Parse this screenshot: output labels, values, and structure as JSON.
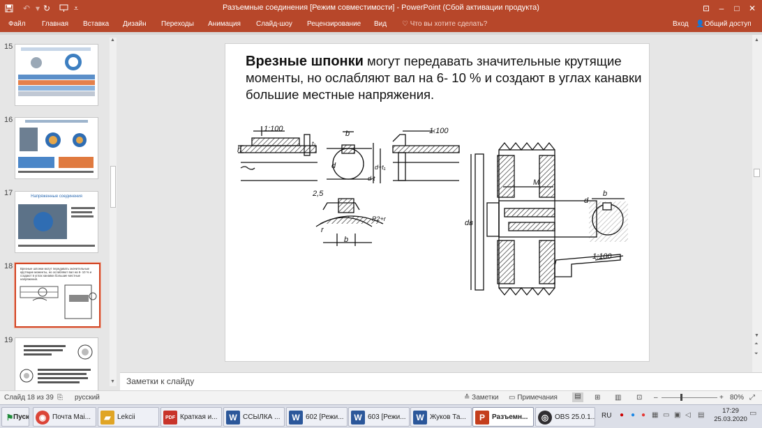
{
  "window": {
    "title": "Разъемные соединения [Режим совместимости] - PowerPoint (Сбой активации продукта)"
  },
  "quick_access": {
    "save_icon": "save-icon",
    "undo_icon": "undo-icon",
    "redo_icon": "redo-icon",
    "slideshow_icon": "present-icon",
    "customize_icon": "chevron-down-icon"
  },
  "window_controls": {
    "restore_icon": "ribbon-display-icon",
    "minimize": "–",
    "maximize": "□",
    "close": "✕"
  },
  "ribbon": {
    "tabs": [
      "Файл",
      "Главная",
      "Вставка",
      "Дизайн",
      "Переходы",
      "Анимация",
      "Слайд-шоу",
      "Рецензирование",
      "Вид"
    ],
    "tell_me": "Что вы хотите сделать?",
    "login": "Вход",
    "share": "Общий доступ"
  },
  "thumbnails": [
    {
      "num": "15",
      "caption": ""
    },
    {
      "num": "16",
      "caption": ""
    },
    {
      "num": "17",
      "caption": "Напряженные соединения"
    },
    {
      "num": "18",
      "caption": "Врезные шпонки могут передавать значительные крутящие моменты, но ослабляют вал на 6- 10 % и создают в углах канавки большие местные напряжения."
    },
    {
      "num": "19",
      "caption": "Шпонки на лыске"
    }
  ],
  "slide": {
    "title_bold": "Врезные шпонки",
    "title_rest": " могут передавать значительные крутящие моменты, но ослабляют вал на 6- 10 % и создают в углах  канавки большие местные напряжения.",
    "drawing_labels": {
      "slope1": "1:100",
      "slope2": "1:100",
      "slope3": "1:100",
      "h": "h",
      "t1": "t₁",
      "b": "b",
      "d": "d",
      "d_t": "d-t",
      "d_t1": "d+t₁",
      "r25": "2,5",
      "r": "r",
      "R": "R2+r",
      "M": "M",
      "dB": "dв",
      "d2": "d",
      "b2": "b"
    }
  },
  "notes": {
    "placeholder": "Заметки к слайду"
  },
  "status": {
    "slide": "Слайд 18 из 39",
    "lang": "русский",
    "notes": "Заметки",
    "comments": "Примечания",
    "zoom": "80%",
    "minus": "–",
    "plus": "+"
  },
  "taskbar": {
    "start": "Пуск",
    "items": [
      {
        "label": "Почта Mai...",
        "icon": "chrome-icon",
        "color": "#db4437"
      },
      {
        "label": "Lekcii",
        "icon": "folder-icon",
        "color": "#e0a526"
      },
      {
        "label": "Краткая и...",
        "icon": "pdf-icon",
        "color": "#c8342a"
      },
      {
        "label": "ССЫЛКА ...",
        "icon": "word-icon",
        "color": "#2b579a"
      },
      {
        "label": "602 [Режи...",
        "icon": "word-icon",
        "color": "#2b579a"
      },
      {
        "label": "603 [Режи...",
        "icon": "word-icon",
        "color": "#2b579a"
      },
      {
        "label": "Жуков Та...",
        "icon": "word-icon",
        "color": "#2b579a"
      },
      {
        "label": "Разъемн...",
        "icon": "powerpoint-icon",
        "color": "#c43e1c"
      },
      {
        "label": "OBS 25.0.1...",
        "icon": "obs-icon",
        "color": "#302e31"
      }
    ],
    "lang": "RU",
    "time": "17:29",
    "date": "25.03.2020"
  }
}
